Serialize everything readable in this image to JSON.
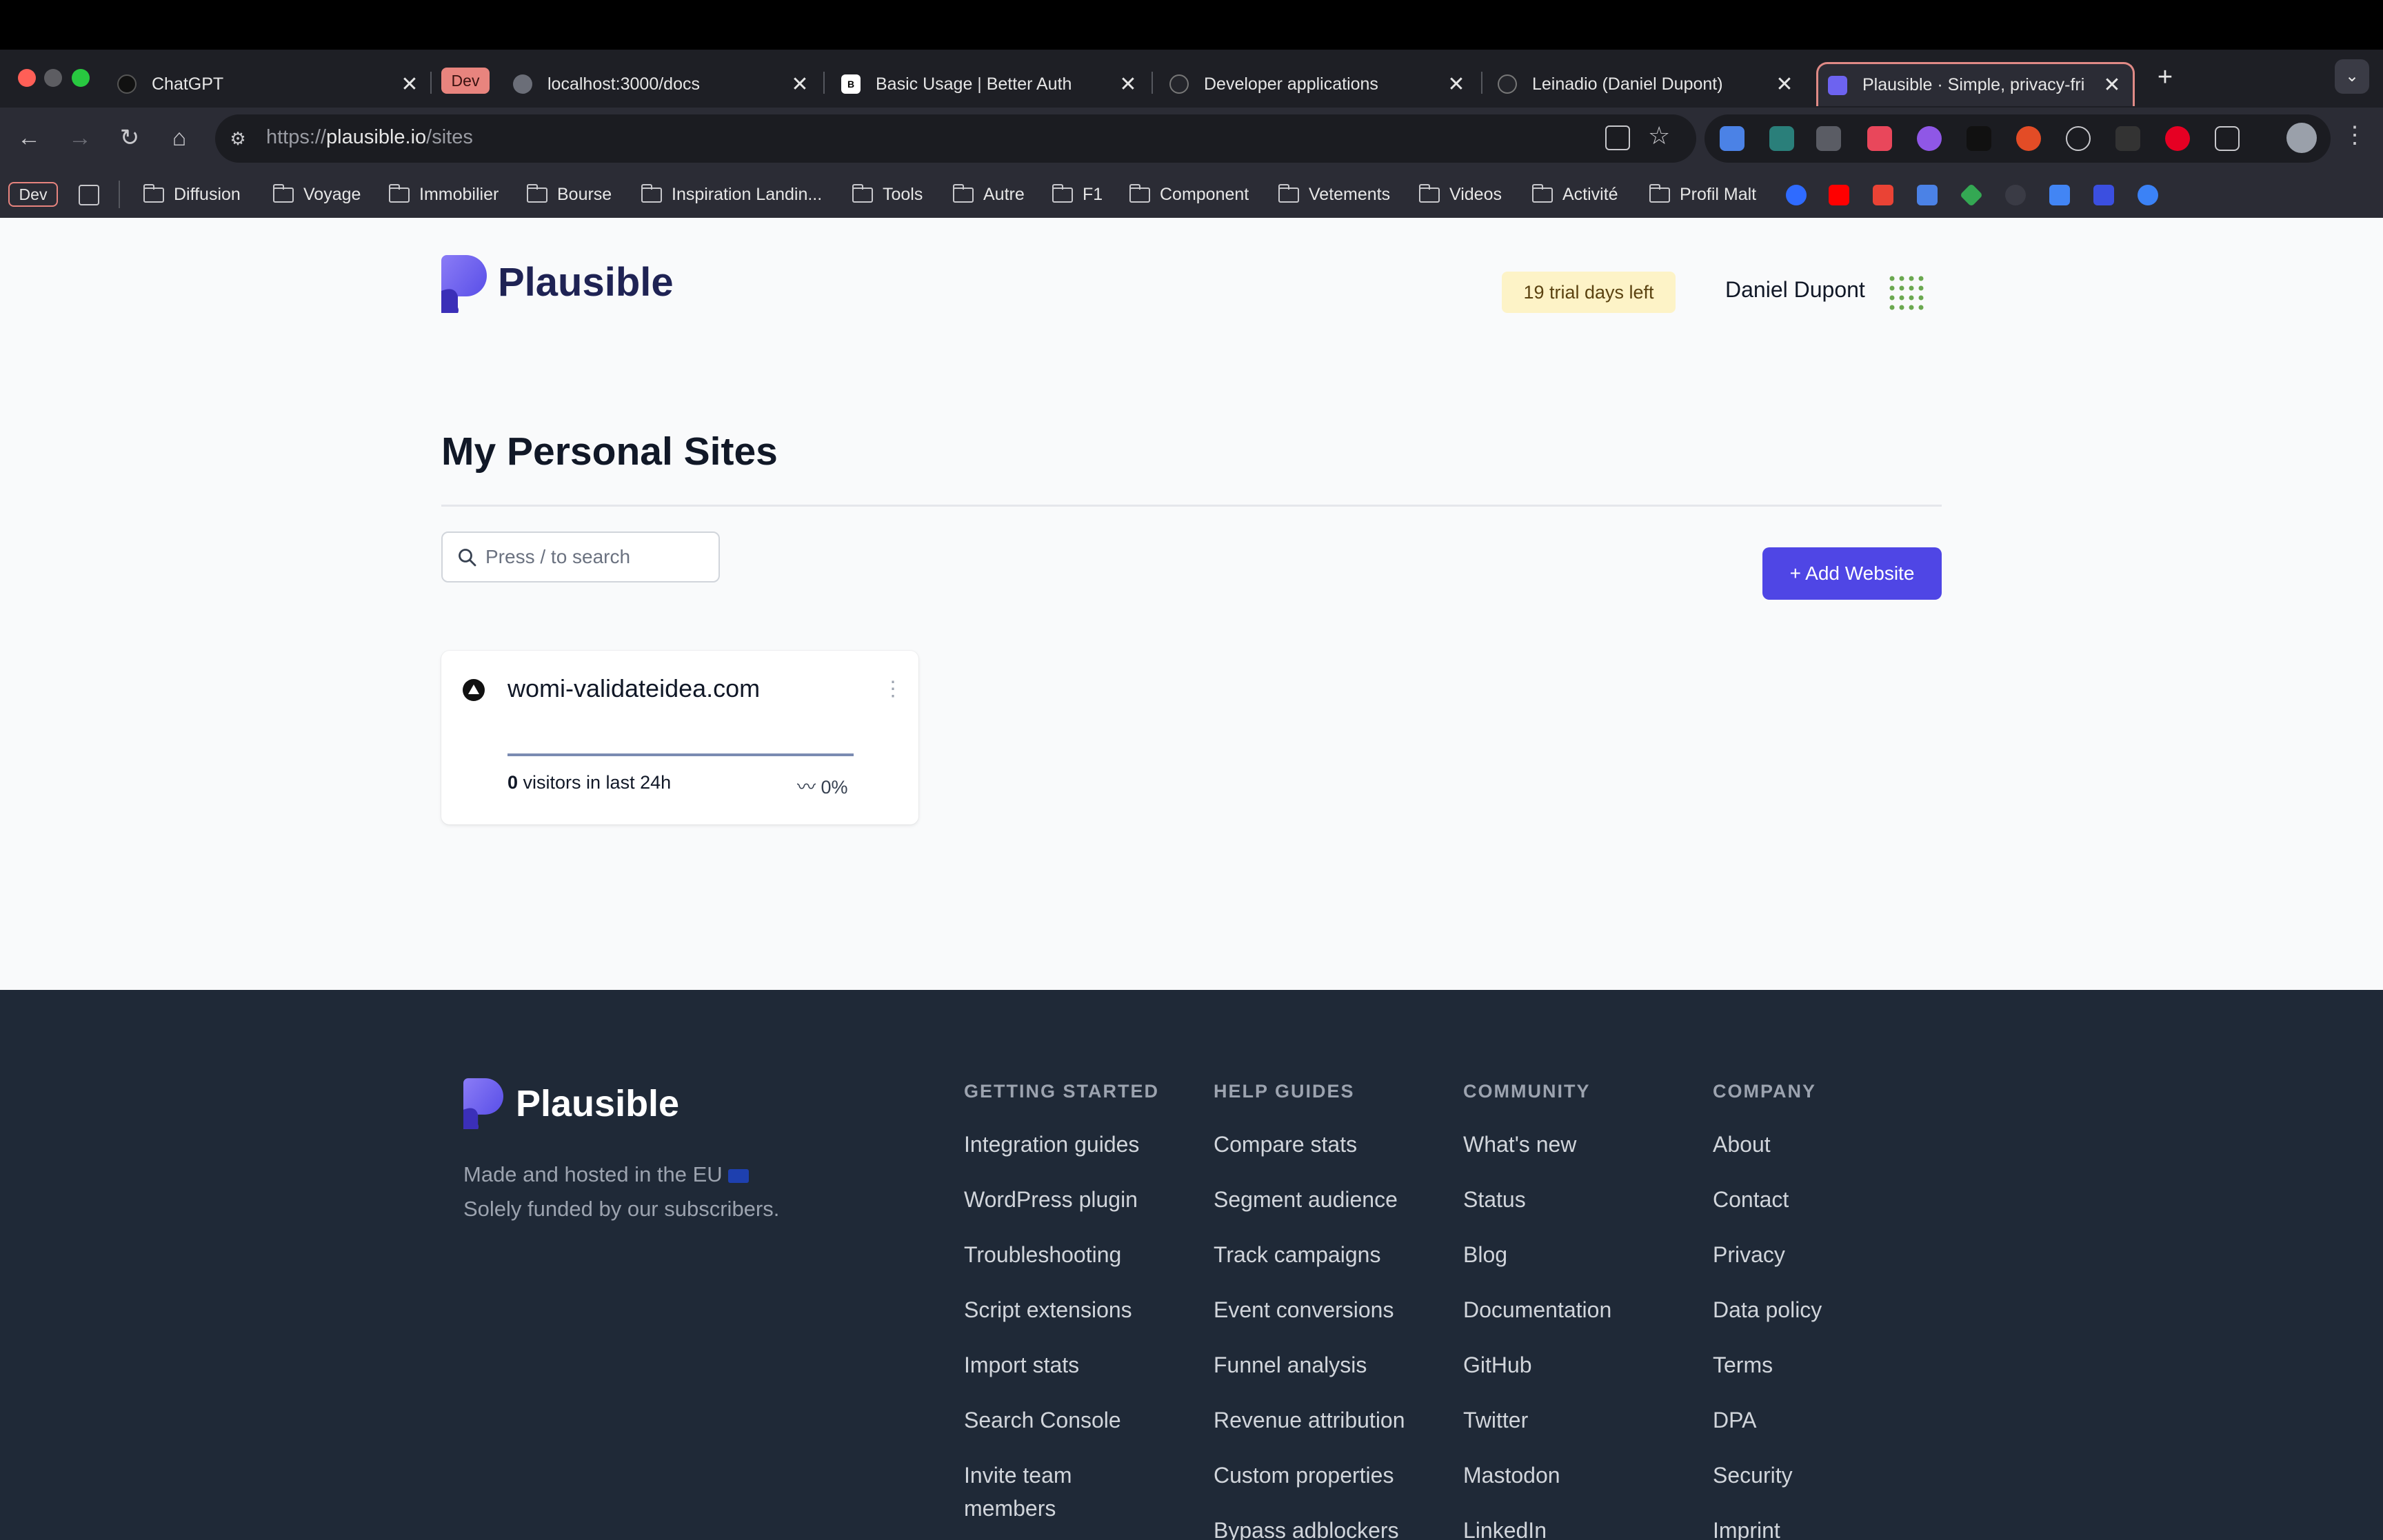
{
  "browser": {
    "tabs": [
      {
        "title": "ChatGPT"
      },
      {
        "title": "localhost:3000/docs",
        "group": "Dev"
      },
      {
        "title": "Basic Usage | Better Auth"
      },
      {
        "title": "Developer applications"
      },
      {
        "title": "Leinadio (Daniel Dupont)"
      },
      {
        "title": "Plausible · Simple, privacy-fri",
        "active": true
      }
    ],
    "url_prefix": "https://",
    "url_host": "plausible.io",
    "url_path": "/sites",
    "bookmarks_group": "Dev",
    "bookmarks": [
      "Diffusion",
      "Voyage",
      "Immobilier",
      "Bourse",
      "Inspiration Landin...",
      "Tools",
      "Autre",
      "F1",
      "Component",
      "Vetements",
      "Videos",
      "Activité",
      "Profil Malt"
    ]
  },
  "header": {
    "logo_text": "Plausible",
    "trial_badge": "19 trial days left",
    "user_name": "Daniel Dupont"
  },
  "main": {
    "title": "My Personal Sites",
    "search_placeholder": "Press / to search",
    "add_button": "+ Add Website",
    "sites": [
      {
        "domain": "womi-validateidea.com",
        "visitors": "0",
        "visitors_label": " visitors in last 24h",
        "change": "0%"
      }
    ]
  },
  "footer": {
    "logo_text": "Plausible",
    "tagline_1": "Made and hosted in the EU",
    "tagline_2": "Solely funded by our subscribers.",
    "columns": [
      {
        "heading": "GETTING STARTED",
        "links": [
          "Integration guides",
          "WordPress plugin",
          "Troubleshooting",
          "Script extensions",
          "Import stats",
          "Search Console",
          "Invite team members"
        ]
      },
      {
        "heading": "HELP GUIDES",
        "links": [
          "Compare stats",
          "Segment audience",
          "Track campaigns",
          "Event conversions",
          "Funnel analysis",
          "Revenue attribution",
          "Custom properties",
          "Bypass adblockers"
        ]
      },
      {
        "heading": "COMMUNITY",
        "links": [
          "What's new",
          "Status",
          "Blog",
          "Documentation",
          "GitHub",
          "Twitter",
          "Mastodon",
          "LinkedIn"
        ]
      },
      {
        "heading": "COMPANY",
        "links": [
          "About",
          "Contact",
          "Privacy",
          "Data policy",
          "Terms",
          "DPA",
          "Security",
          "Imprint"
        ]
      }
    ]
  },
  "colors": {
    "brand": "#4f46e5",
    "footer_bg": "#1f2937",
    "trial_bg": "#fdf3c7",
    "tab_border": "#e08a86"
  },
  "icons": {
    "site_favicon": "triangle-up-icon",
    "search": "search-icon",
    "user_menu": "grid-dots-icon",
    "trend": "squiggle-icon"
  }
}
